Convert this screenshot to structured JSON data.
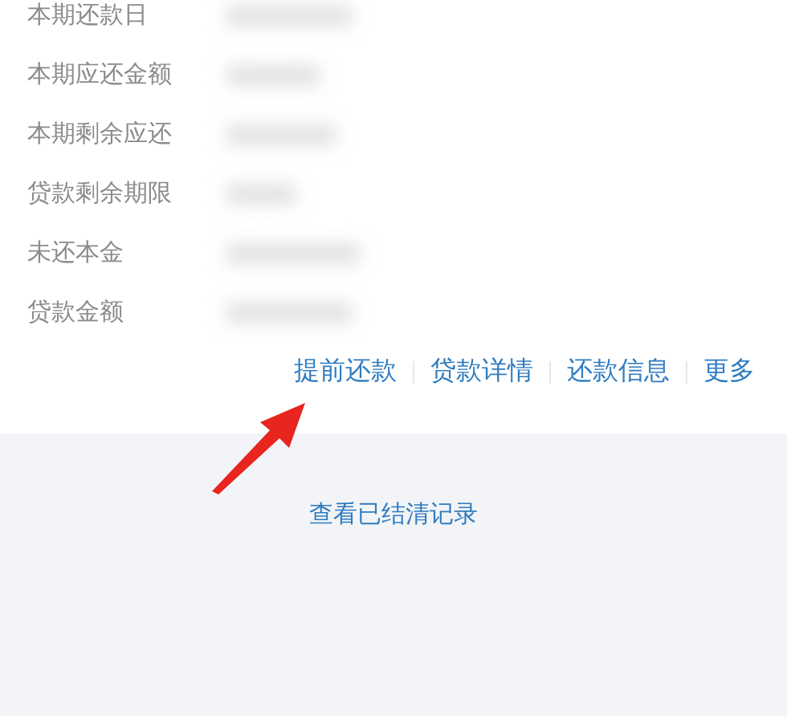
{
  "details": [
    {
      "label": "本期还款日"
    },
    {
      "label": "本期应还金额"
    },
    {
      "label": "本期剩余应还"
    },
    {
      "label": "贷款剩余期限"
    },
    {
      "label": "未还本金"
    },
    {
      "label": "贷款金额"
    }
  ],
  "actions": [
    {
      "label": "提前还款"
    },
    {
      "label": "贷款详情"
    },
    {
      "label": "还款信息"
    },
    {
      "label": "更多"
    }
  ],
  "history_link": "查看已结清记录"
}
